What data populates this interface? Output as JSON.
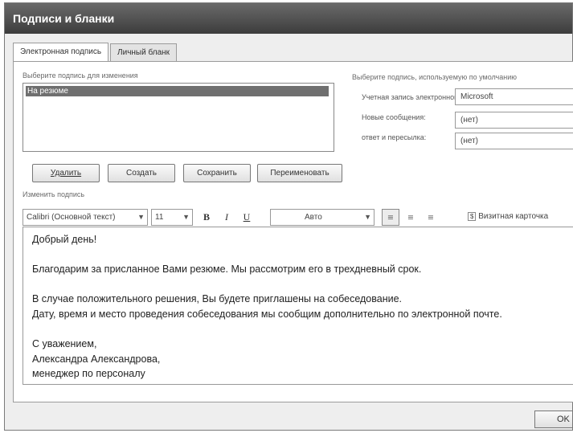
{
  "window": {
    "title": "Подписи и бланки"
  },
  "tabs": [
    {
      "label": "Электронная подпись",
      "active": true
    },
    {
      "label": "Личный бланк",
      "active": false
    }
  ],
  "left": {
    "select_label": "Выберите подпись для изменения",
    "signatures": [
      "На резюме"
    ],
    "buttons": {
      "delete": "Удалить",
      "create": "Создать",
      "save": "Сохранить",
      "rename": "Переименовать"
    }
  },
  "right": {
    "default_label": "Выберите подпись, используемую по умолчанию",
    "account_label": "Учетная запись электронной почты:",
    "account_value": "Microsoft",
    "new_messages_label": "Новые сообщения:",
    "new_messages_value": "(нет)",
    "reply_forward_label": "ответ и пересылка:",
    "reply_forward_value": "(нет)"
  },
  "edit": {
    "label": "Изменить подпись",
    "font": "Calibri (Основной текст)",
    "size": "11",
    "bold_icon": "B",
    "italic_icon": "I",
    "underline_icon": "U",
    "color": "Авто",
    "business_card": "Визитная карточка",
    "icons": [
      "bold-icon",
      "italic-icon",
      "underline-icon",
      "align-left-icon",
      "align-center-icon",
      "align-right-icon",
      "business-card-icon"
    ],
    "lines": [
      "Добрый день!",
      "",
      "Благодарим за присланное Вами резюме. Мы рассмотрим его в трехдневный срок.",
      "",
      "В случае положительного решения, Вы будете приглашены на собеседование.",
      "Дату, время и место проведения собеседования мы сообщим дополнительно по электронной почте.",
      "",
      "С уважением,",
      "Александра Александрова,",
      "менеджер по персоналу"
    ]
  },
  "footer": {
    "ok": "OK"
  }
}
